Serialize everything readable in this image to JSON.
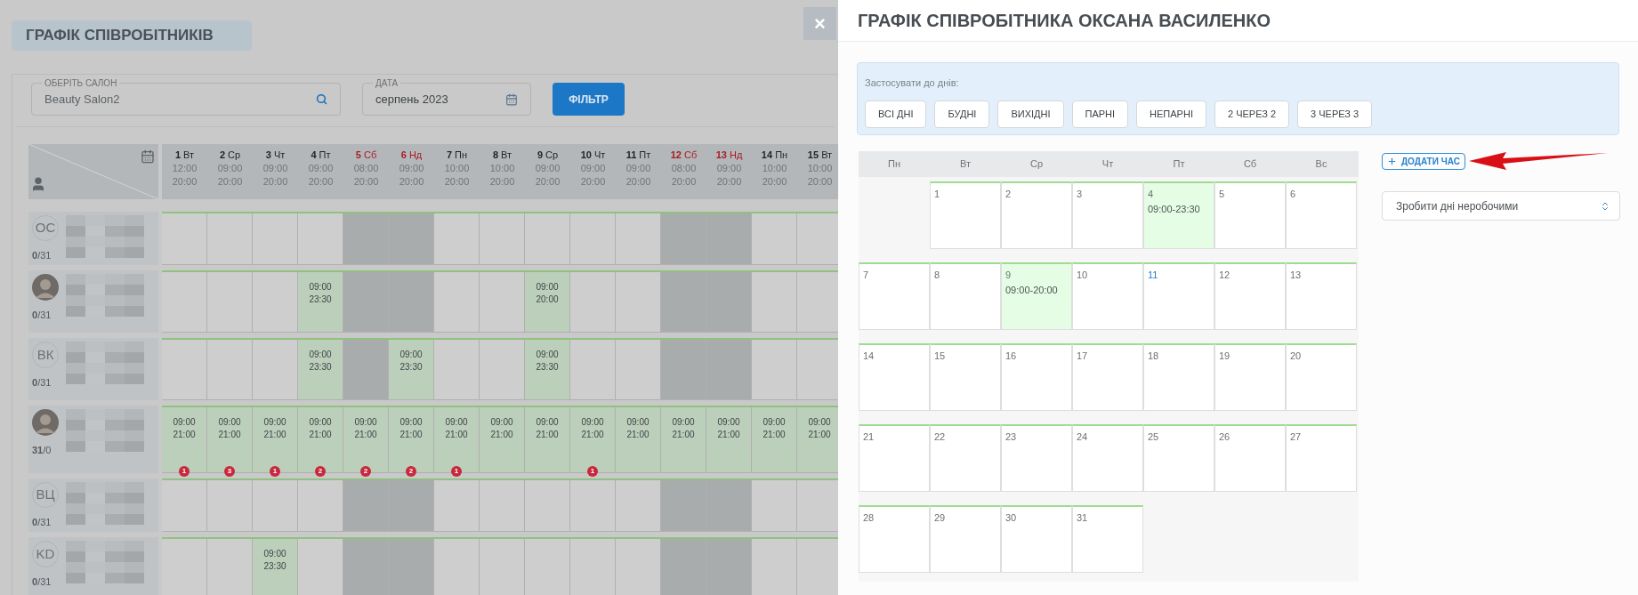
{
  "page_title": "ГРАФІК СПІВРОБІТНИКІВ",
  "close_label": "×",
  "filters": {
    "salon": {
      "label": "ОБЕРІТЬ САЛОН",
      "value": "Beauty Salon2"
    },
    "date": {
      "label": "ДАТА",
      "value": "серпень 2023"
    },
    "button": "ФІЛЬТР"
  },
  "days": [
    {
      "label": "**1** Вт",
      "weekend": false,
      "start": "12:00",
      "end": "20:00"
    },
    {
      "label": "**2** Ср",
      "weekend": false,
      "start": "09:00",
      "end": "20:00"
    },
    {
      "label": "**3** Чт",
      "weekend": false,
      "start": "09:00",
      "end": "20:00"
    },
    {
      "label": "**4** Пт",
      "weekend": false,
      "start": "09:00",
      "end": "20:00"
    },
    {
      "label": "**5** Сб",
      "weekend": true,
      "start": "08:00",
      "end": "20:00"
    },
    {
      "label": "**6** Нд",
      "weekend": true,
      "start": "09:00",
      "end": "20:00"
    },
    {
      "label": "**7** Пн",
      "weekend": false,
      "start": "10:00",
      "end": "20:00"
    },
    {
      "label": "**8** Вт",
      "weekend": false,
      "start": "10:00",
      "end": "20:00"
    },
    {
      "label": "**9** Ср",
      "weekend": false,
      "start": "09:00",
      "end": "20:00"
    },
    {
      "label": "**10** Чт",
      "weekend": false,
      "start": "09:00",
      "end": "20:00"
    },
    {
      "label": "**11** Пт",
      "weekend": false,
      "start": "09:00",
      "end": "20:00"
    },
    {
      "label": "**12** Сб",
      "weekend": true,
      "start": "08:00",
      "end": "20:00"
    },
    {
      "label": "**13** Нд",
      "weekend": true,
      "start": "09:00",
      "end": "20:00"
    },
    {
      "label": "**14** Пн",
      "weekend": false,
      "start": "10:00",
      "end": "20:00"
    },
    {
      "label": "**15** Вт",
      "weekend": false,
      "start": "10:00",
      "end": "20:00"
    }
  ],
  "employees": [
    {
      "kind": "initials",
      "initials": "ОС",
      "count": "**0**/31",
      "cells": [
        {
          "working": false
        },
        {
          "working": false
        },
        {
          "working": false
        },
        {
          "working": false
        },
        {
          "working": false
        },
        {
          "working": false
        },
        {
          "working": false
        },
        {
          "working": false
        },
        {
          "working": false
        },
        {
          "working": false
        },
        {
          "working": false
        },
        {
          "working": false
        },
        {
          "working": false
        },
        {
          "working": false
        },
        {
          "working": false
        }
      ]
    },
    {
      "kind": "photo",
      "count": "**0**/31",
      "cells": [
        {
          "working": false
        },
        {
          "working": false
        },
        {
          "working": false
        },
        {
          "working": true,
          "start": "09:00",
          "end": "23:30"
        },
        {
          "working": false
        },
        {
          "working": false
        },
        {
          "working": false
        },
        {
          "working": false
        },
        {
          "working": true,
          "start": "09:00",
          "end": "20:00"
        },
        {
          "working": false
        },
        {
          "working": false
        },
        {
          "working": false
        },
        {
          "working": false
        },
        {
          "working": false
        },
        {
          "working": false
        }
      ]
    },
    {
      "kind": "initials",
      "initials": "ВК",
      "count": "**0**/31",
      "cells": [
        {
          "working": false
        },
        {
          "working": false
        },
        {
          "working": false
        },
        {
          "working": true,
          "start": "09:00",
          "end": "23:30"
        },
        {
          "working": false
        },
        {
          "working": true,
          "start": "09:00",
          "end": "23:30"
        },
        {
          "working": false
        },
        {
          "working": false
        },
        {
          "working": true,
          "start": "09:00",
          "end": "23:30"
        },
        {
          "working": false
        },
        {
          "working": false
        },
        {
          "working": false
        },
        {
          "working": false
        },
        {
          "working": false
        },
        {
          "working": false
        }
      ]
    },
    {
      "kind": "photo",
      "count": "**31**/0",
      "cells": [
        {
          "working": true,
          "start": "09:00",
          "end": "21:00",
          "badge": "1"
        },
        {
          "working": true,
          "start": "09:00",
          "end": "21:00",
          "badge": "3"
        },
        {
          "working": true,
          "start": "09:00",
          "end": "21:00",
          "badge": "1"
        },
        {
          "working": true,
          "start": "09:00",
          "end": "21:00",
          "badge": "2"
        },
        {
          "working": true,
          "start": "09:00",
          "end": "21:00",
          "badge": "2"
        },
        {
          "working": true,
          "start": "09:00",
          "end": "21:00",
          "badge": "2"
        },
        {
          "working": true,
          "start": "09:00",
          "end": "21:00",
          "badge": "1"
        },
        {
          "working": true,
          "start": "09:00",
          "end": "21:00"
        },
        {
          "working": true,
          "start": "09:00",
          "end": "21:00"
        },
        {
          "working": true,
          "start": "09:00",
          "end": "21:00",
          "badge": "1"
        },
        {
          "working": true,
          "start": "09:00",
          "end": "21:00"
        },
        {
          "working": true,
          "start": "09:00",
          "end": "21:00"
        },
        {
          "working": true,
          "start": "09:00",
          "end": "21:00"
        },
        {
          "working": true,
          "start": "09:00",
          "end": "21:00"
        },
        {
          "working": true,
          "start": "09:00",
          "end": "21:00"
        }
      ]
    },
    {
      "kind": "initials",
      "initials": "ВЦ",
      "count": "**0**/31",
      "cells": [
        {
          "working": false
        },
        {
          "working": false
        },
        {
          "working": false
        },
        {
          "working": false
        },
        {
          "working": false
        },
        {
          "working": false
        },
        {
          "working": false
        },
        {
          "working": false
        },
        {
          "working": false
        },
        {
          "working": false
        },
        {
          "working": false
        },
        {
          "working": false
        },
        {
          "working": false
        },
        {
          "working": false
        },
        {
          "working": false
        }
      ]
    },
    {
      "kind": "initials",
      "initials": "KD",
      "count": "**0**/31",
      "cells": [
        {
          "working": false
        },
        {
          "working": false
        },
        {
          "working": true,
          "start": "09:00",
          "end": "23:30"
        },
        {
          "working": false
        },
        {
          "working": false
        },
        {
          "working": false
        },
        {
          "working": false
        },
        {
          "working": false
        },
        {
          "working": false
        },
        {
          "working": false
        },
        {
          "working": false
        },
        {
          "working": false
        },
        {
          "working": false
        },
        {
          "working": false
        },
        {
          "working": false
        }
      ]
    }
  ],
  "panel": {
    "title": "ГРАФІК СПІВРОБІТНИКА ОКСАНА ВАСИЛЕНКО",
    "apply_label": "Застосувати до днів:",
    "presets": [
      "ВСІ ДНІ",
      "БУДНІ",
      "ВИХІДНІ",
      "ПАРНІ",
      "НЕПАРНІ",
      "2 ЧЕРЕЗ 2",
      "3 ЧЕРЕЗ 3"
    ],
    "weekdays": [
      "Пн",
      "Вт",
      "Ср",
      "Чт",
      "Пт",
      "Сб",
      "Вс"
    ],
    "weeks": [
      {
        "days": [
          {
            "kind": "blank"
          },
          {
            "kind": "day",
            "num": "1",
            "working": false,
            "today": false
          },
          {
            "kind": "day",
            "num": "2",
            "working": false,
            "today": false
          },
          {
            "kind": "day",
            "num": "3",
            "working": false,
            "today": false
          },
          {
            "kind": "day",
            "num": "4",
            "working": true,
            "today": false,
            "hours": "09:00-23:30"
          },
          {
            "kind": "day",
            "num": "5",
            "working": false,
            "today": false
          },
          {
            "kind": "day",
            "num": "6",
            "working": false,
            "today": false
          }
        ]
      },
      {
        "days": [
          {
            "kind": "day",
            "num": "7",
            "working": false,
            "today": false
          },
          {
            "kind": "day",
            "num": "8",
            "working": false,
            "today": false
          },
          {
            "kind": "day",
            "num": "9",
            "working": true,
            "today": false,
            "hours": "09:00-20:00"
          },
          {
            "kind": "day",
            "num": "10",
            "working": false,
            "today": false
          },
          {
            "kind": "day",
            "num": "11",
            "working": false,
            "today": true
          },
          {
            "kind": "day",
            "num": "12",
            "working": false,
            "today": false
          },
          {
            "kind": "day",
            "num": "13",
            "working": false,
            "today": false
          }
        ]
      },
      {
        "days": [
          {
            "kind": "day",
            "num": "14",
            "working": false,
            "today": false
          },
          {
            "kind": "day",
            "num": "15",
            "working": false,
            "today": false
          },
          {
            "kind": "day",
            "num": "16",
            "working": false,
            "today": false
          },
          {
            "kind": "day",
            "num": "17",
            "working": false,
            "today": false
          },
          {
            "kind": "day",
            "num": "18",
            "working": false,
            "today": false
          },
          {
            "kind": "day",
            "num": "19",
            "working": false,
            "today": false
          },
          {
            "kind": "day",
            "num": "20",
            "working": false,
            "today": false
          }
        ]
      },
      {
        "days": [
          {
            "kind": "day",
            "num": "21",
            "working": false,
            "today": false
          },
          {
            "kind": "day",
            "num": "22",
            "working": false,
            "today": false
          },
          {
            "kind": "day",
            "num": "23",
            "working": false,
            "today": false
          },
          {
            "kind": "day",
            "num": "24",
            "working": false,
            "today": false
          },
          {
            "kind": "day",
            "num": "25",
            "working": false,
            "today": false
          },
          {
            "kind": "day",
            "num": "26",
            "working": false,
            "today": false
          },
          {
            "kind": "day",
            "num": "27",
            "working": false,
            "today": false
          }
        ]
      },
      {
        "days": [
          {
            "kind": "day",
            "num": "28",
            "working": false,
            "today": false
          },
          {
            "kind": "day",
            "num": "29",
            "working": false,
            "today": false
          },
          {
            "kind": "day",
            "num": "30",
            "working": false,
            "today": false
          },
          {
            "kind": "day",
            "num": "31",
            "working": false,
            "today": false
          },
          {
            "kind": "blank"
          },
          {
            "kind": "blank"
          },
          {
            "kind": "blank"
          }
        ]
      }
    ],
    "add_time": "ДОДАТИ ЧАС",
    "select": "Зробити дні неробочими"
  }
}
